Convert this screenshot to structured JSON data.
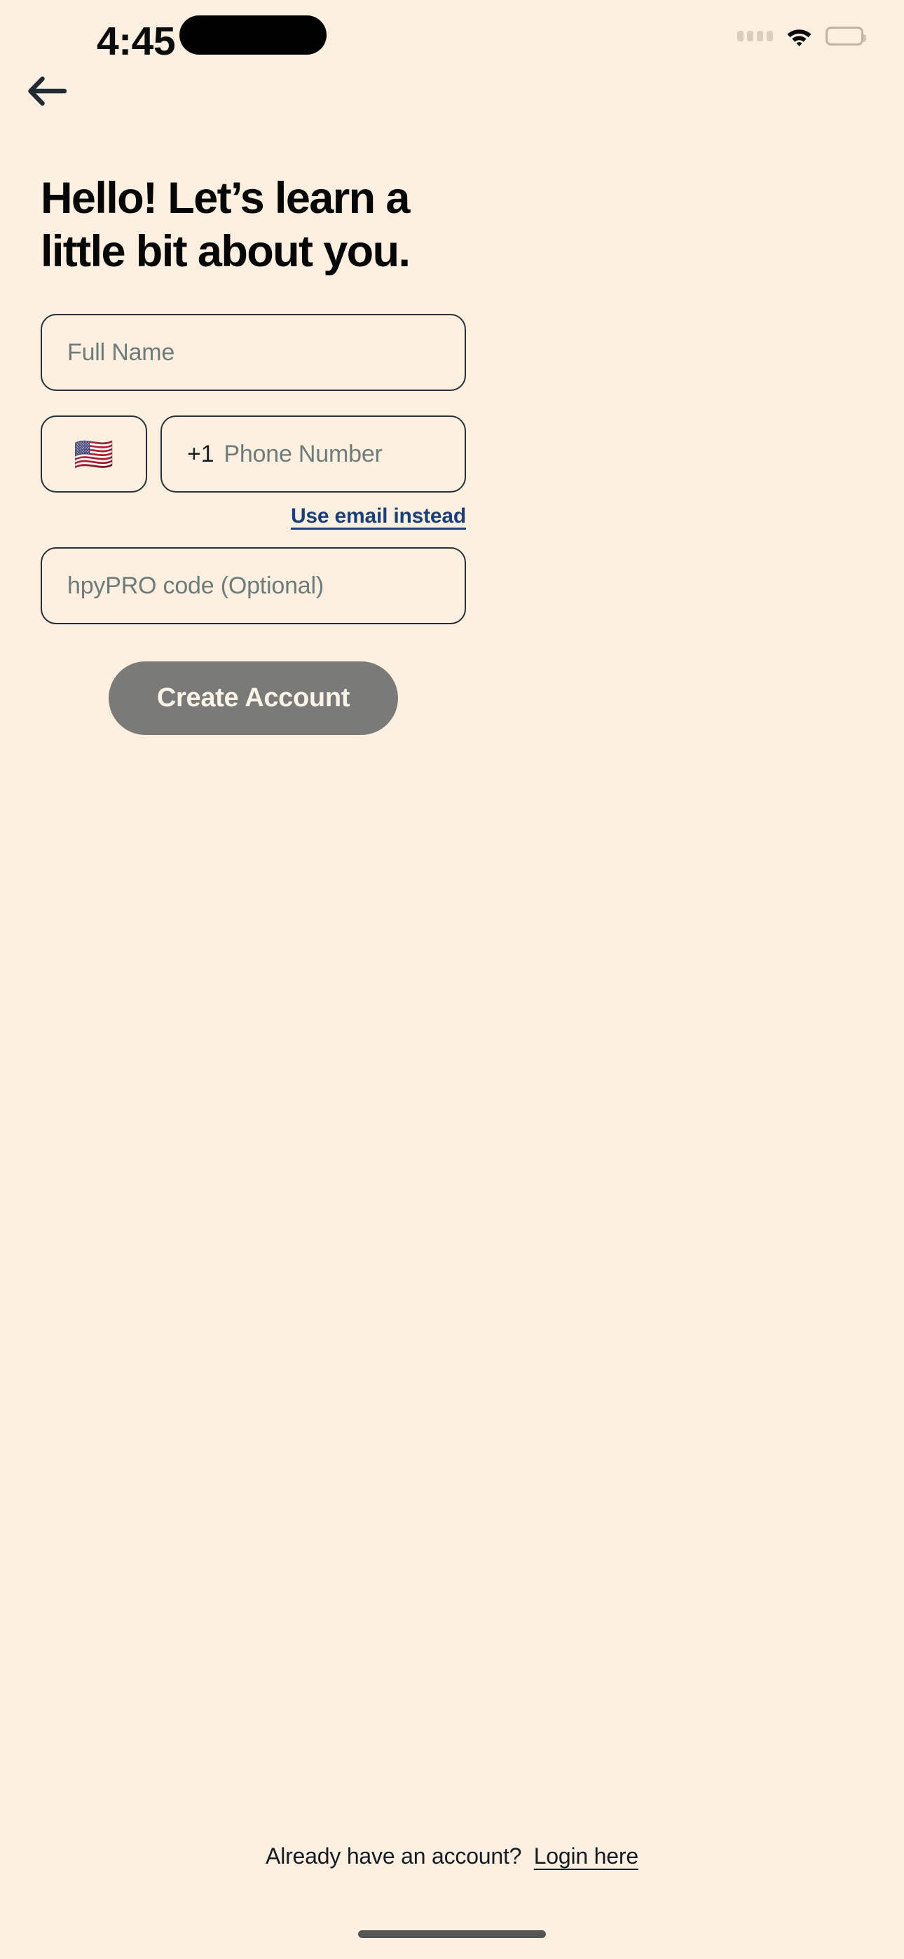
{
  "status_bar": {
    "time": "4:45",
    "signal_icon": "signal-dots-icon",
    "wifi_icon": "wifi-icon",
    "battery_icon": "battery-icon"
  },
  "nav": {
    "back_icon": "back-arrow-icon"
  },
  "heading": {
    "line1": "Hello! Let’s learn a",
    "line2": "little bit about you."
  },
  "form": {
    "full_name": {
      "value": "",
      "placeholder": "Full Name"
    },
    "country": {
      "flag": "🇺🇸",
      "icon": "us-flag-icon"
    },
    "phone": {
      "country_code": "+1",
      "value": "",
      "placeholder": "Phone Number"
    },
    "use_email_link": "Use email instead",
    "promo": {
      "value": "",
      "placeholder": "hpyPRO code (Optional)"
    },
    "submit_label": "Create Account"
  },
  "footer": {
    "prompt": "Already have an account?",
    "login_link": "Login here"
  },
  "colors": {
    "background": "#FDF0E0",
    "border": "#2A2E35",
    "placeholder": "#6F7B7B",
    "link": "#1A3E77",
    "button_disabled": "#7A7A78",
    "button_text": "#FBF3E8",
    "text": "#060606"
  }
}
